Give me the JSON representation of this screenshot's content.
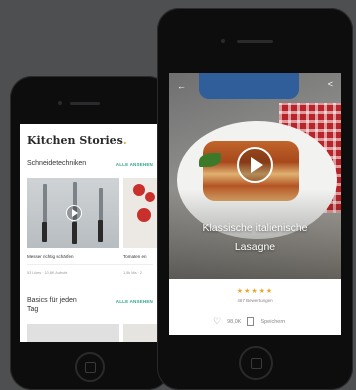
{
  "left_app": {
    "brand": "Kitchen Stories",
    "brand_dot": ".",
    "section1": {
      "title": "Schneidetechniken",
      "link": "ALLE ANSEHEN"
    },
    "cards": [
      {
        "caption": "Messer richtig schärfen",
        "meta": "53 Likes · 10,8K Aufrufe"
      },
      {
        "caption": "Tomaten en",
        "meta": "1,5k Ma · 2"
      }
    ],
    "section2": {
      "title_line1": "Basics für jeden",
      "title_line2": "Tag",
      "link": "ALLE ANSEHEN"
    }
  },
  "right_app": {
    "recipe_title_line1": "Klassische italienische",
    "recipe_title_line2": "Lasagne",
    "stars": "★★★★★",
    "ratings": "467 Bewertungen",
    "likes": "98,0K",
    "save_label": "Speichern"
  },
  "colors": {
    "accent": "#2fa58c",
    "star": "#e3a933",
    "background": "#4e4f51"
  },
  "icons": [
    "back-arrow-icon",
    "share-icon",
    "play-icon",
    "heart-icon",
    "bookmark-icon"
  ]
}
